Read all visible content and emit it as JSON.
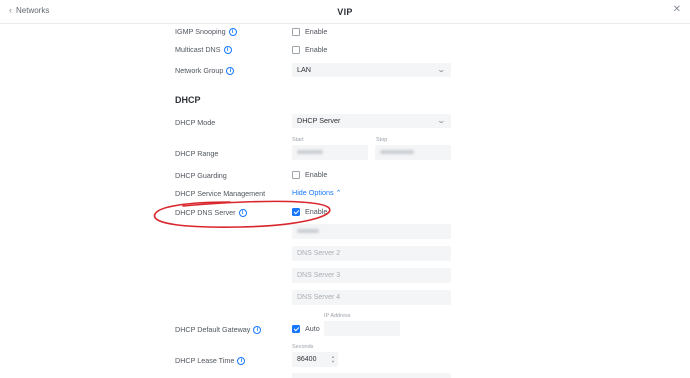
{
  "header": {
    "back_label": "Networks",
    "title": "VIP",
    "close_glyph": "✕"
  },
  "rows": {
    "igmp": {
      "label": "IGMP Snooping",
      "checkbox": "Enable",
      "checked": false
    },
    "mdns": {
      "label": "Multicast DNS",
      "checkbox": "Enable",
      "checked": false
    },
    "group": {
      "label": "Network Group",
      "value": "LAN"
    }
  },
  "dhcp": {
    "section_title": "DHCP",
    "mode": {
      "label": "DHCP Mode",
      "value": "DHCP Server"
    },
    "range": {
      "label": "DHCP Range",
      "start_label": "Start",
      "stop_label": "Stop"
    },
    "guarding": {
      "label": "DHCP Guarding",
      "checkbox": "Enable",
      "checked": false
    },
    "service": {
      "label": "DHCP Service Management",
      "link": "Hide Options"
    },
    "dns": {
      "label": "DHCP DNS Server",
      "checkbox": "Enable",
      "checked": true,
      "server2_placeholder": "DNS Server 2",
      "server3_placeholder": "DNS Server 3",
      "server4_placeholder": "DNS Server 4"
    },
    "gateway": {
      "label": "DHCP Default Gateway",
      "checkbox": "Auto",
      "checked": true,
      "ip_label": "IP Address"
    },
    "lease": {
      "label": "DHCP Lease Time",
      "unit_label": "Seconds",
      "value": "86400"
    }
  },
  "annotation_color": "#d9262c",
  "accent_color": "#1677ff"
}
